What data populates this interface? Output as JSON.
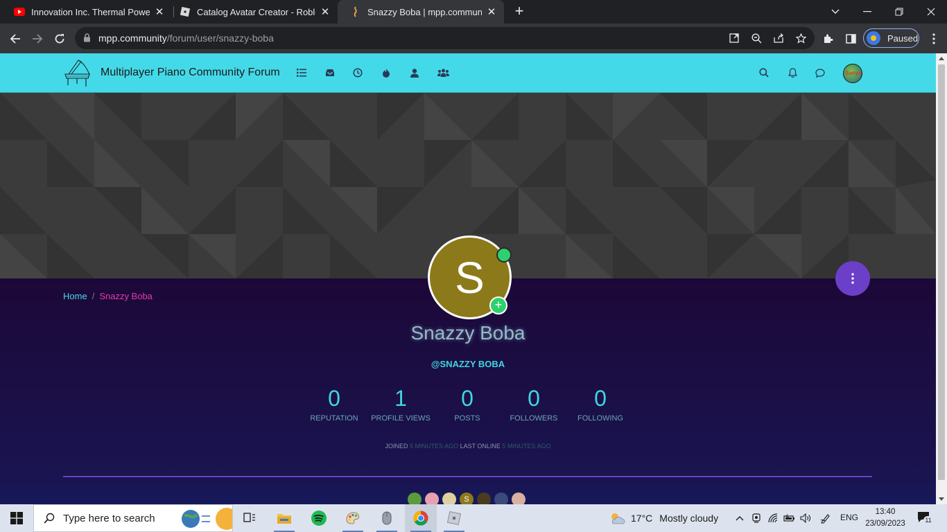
{
  "browser": {
    "tabs": [
      {
        "title": "Innovation Inc. Thermal Power Pla",
        "favicon": "youtube-icon"
      },
      {
        "title": "Catalog Avatar Creator - Roblox",
        "favicon": "roblox-icon"
      },
      {
        "title": "Snazzy Boba | mpp.community",
        "favicon": "mpp-icon",
        "active": true
      }
    ],
    "url_host": "mpp.community",
    "url_path": "/forum/user/snazzy-boba",
    "profile_status": "Paused"
  },
  "site": {
    "brand": "Multiplayer Piano Community Forum",
    "nav_icons": [
      "categories-icon",
      "inbox-icon",
      "recent-icon",
      "popular-icon",
      "user-icon",
      "groups-icon"
    ],
    "header_icons": [
      "search-icon",
      "bell-icon",
      "chat-icon"
    ],
    "header_avatar_text": "Sanyo"
  },
  "profile": {
    "breadcrumb": {
      "home": "Home",
      "separator": "/",
      "current": "Snazzy Boba"
    },
    "avatar_letter": "S",
    "display_name": "Snazzy Boba",
    "username": "@SNAZZY BOBA",
    "stats": [
      {
        "value": "0",
        "label": "REPUTATION"
      },
      {
        "value": "1",
        "label": "PROFILE VIEWS"
      },
      {
        "value": "0",
        "label": "POSTS"
      },
      {
        "value": "0",
        "label": "FOLLOWERS"
      },
      {
        "value": "0",
        "label": "FOLLOWING"
      }
    ],
    "joined_label": "JOINED",
    "joined_value": "5 MINUTES AGO",
    "last_online_label": "LAST ONLINE",
    "last_online_value": "5 MINUTES AGO",
    "follower_avatar_letter": "S",
    "colors": {
      "accent": "#44d9e8",
      "avatar_bg": "#8c7a1a",
      "fab": "#6b3fc7",
      "crumb_current": "#e43aa9"
    }
  },
  "taskbar": {
    "search_placeholder": "Type here to search",
    "weather_temp": "17°C",
    "weather_desc": "Mostly cloudy",
    "language": "ENG",
    "time": "13:40",
    "date": "23/09/2023",
    "notification_count": "11"
  }
}
